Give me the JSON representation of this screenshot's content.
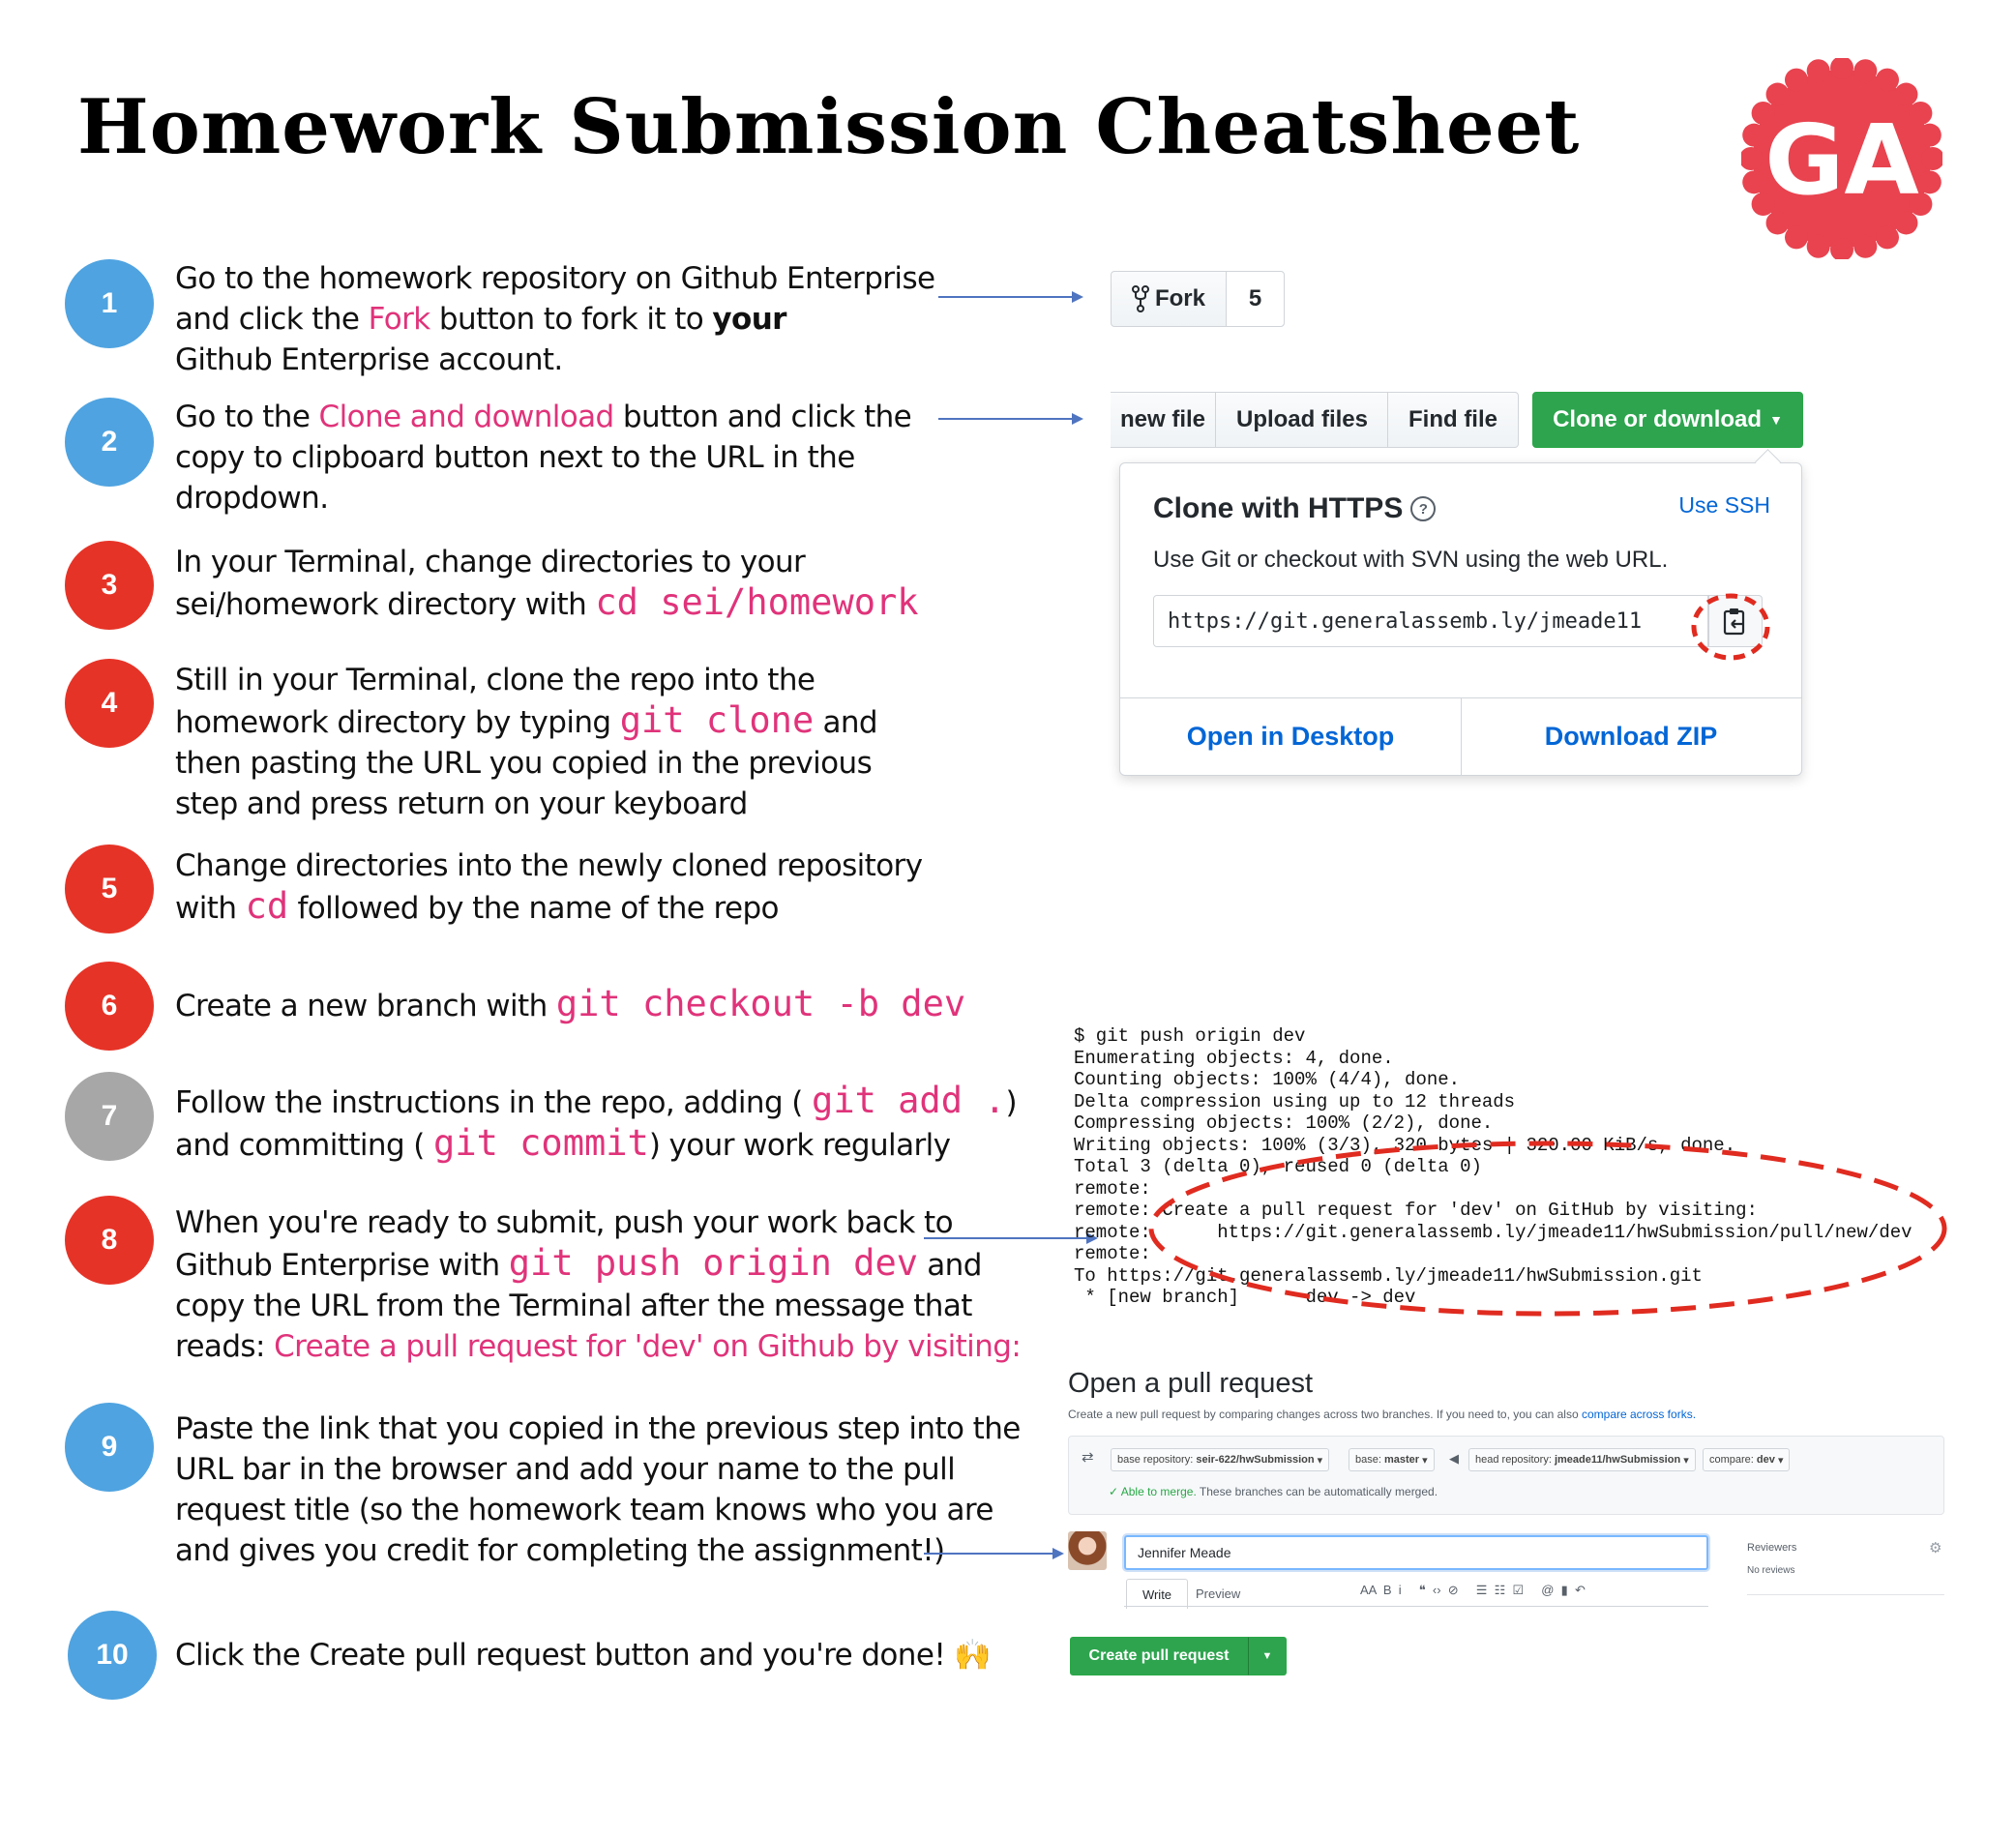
{
  "title": "Homework Submission Cheatsheet",
  "logo": {
    "text": "GA",
    "color": "#e8434f"
  },
  "colors": {
    "pink": "#e0337a",
    "blue": "#4fa3e0",
    "red": "#e63327",
    "gray": "#a7a7a7",
    "green": "#2ea44f"
  },
  "steps": [
    {
      "num": "1",
      "color": "blue"
    },
    {
      "num": "2",
      "color": "blue"
    },
    {
      "num": "3",
      "color": "red"
    },
    {
      "num": "4",
      "color": "red"
    },
    {
      "num": "5",
      "color": "red"
    },
    {
      "num": "6",
      "color": "red"
    },
    {
      "num": "7",
      "color": "gray"
    },
    {
      "num": "8",
      "color": "red"
    },
    {
      "num": "9",
      "color": "blue"
    },
    {
      "num": "10",
      "color": "blue"
    }
  ],
  "text": {
    "s1a": "Go to the homework repository on Github Enterprise",
    "s1b_pre": "and click the ",
    "s1b_hl": "Fork",
    "s1b_mid": " button to fork it to ",
    "s1b_bold": "your",
    "s1c": "Github Enterprise account.",
    "s2a_pre": "Go to the ",
    "s2a_hl": "Clone and download",
    "s2a_post": " button and click the",
    "s2b": "copy to clipboard button next to the URL in the",
    "s2c": "dropdown.",
    "s3a": "In your Terminal, change directories to your",
    "s3b_pre": "sei/homework directory with ",
    "s3b_code": "cd sei/homework",
    "s4a": "Still in your Terminal, clone the repo into the",
    "s4b_pre": "homework directory by typing ",
    "s4b_code": "git clone",
    "s4b_post": "  and",
    "s4c": "then pasting the URL you copied in the previous",
    "s4d": "step and press return on your keyboard",
    "s5a": "Change directories into the newly cloned repository",
    "s5b_pre": "with ",
    "s5b_code": "cd",
    "s5b_post": "  followed by the name of the repo",
    "s6_pre": "Create a new branch with ",
    "s6_code": "git checkout -b dev",
    "s7a_pre": "Follow the instructions in the repo, adding ( ",
    "s7a_code": "git add .",
    "s7a_post": ")",
    "s7b_pre": "and committing ( ",
    "s7b_code": "git commit",
    "s7b_post": ") your work regularly",
    "s8a": "When you're ready to submit, push your work back to",
    "s8b_pre": "Github Enterprise with ",
    "s8b_code": "git push origin dev",
    "s8b_post": "  and",
    "s8c": "copy the URL from the Terminal after the message that",
    "s8d_pre": "reads: ",
    "s8d_hl": "Create a pull request for 'dev' on Github by visiting:",
    "s9a": "Paste the link that you copied in the previous step into the",
    "s9b": "URL bar in the browser and add your name to the pull",
    "s9c": "request title (so the homework team knows who you are",
    "s9d": "and gives you credit for completing the assignment!)",
    "s10": "Click the Create pull request button and you're done! 🙌"
  },
  "fork": {
    "label": "Fork",
    "count": "5"
  },
  "clone": {
    "btn_new_file": "new file",
    "btn_upload": "Upload files",
    "btn_find": "Find file",
    "btn_clone": "Clone or download",
    "heading": "Clone with HTTPS",
    "use_ssh": "Use SSH",
    "desc": "Use Git or checkout with SVN using the web URL.",
    "url": "https://git.generalassemb.ly/jmeade11",
    "open_desktop": "Open in Desktop",
    "download_zip": "Download ZIP"
  },
  "terminal": [
    "$ git push origin dev",
    "Enumerating objects: 4, done.",
    "Counting objects: 100% (4/4), done.",
    "Delta compression using up to 12 threads",
    "Compressing objects: 100% (2/2), done.",
    "Writing objects: 100% (3/3), 320 bytes | 320.00 KiB/s, done.",
    "Total 3 (delta 0), reused 0 (delta 0)",
    "remote:",
    "remote: Create a pull request for 'dev' on GitHub by visiting:",
    "remote:      https://git.generalassemb.ly/jmeade11/hwSubmission/pull/new/dev",
    "remote:",
    "To https://git.generalassemb.ly/jmeade11/hwSubmission.git",
    " * [new branch]      dev -> dev"
  ],
  "pr": {
    "heading": "Open a pull request",
    "desc": "Create a new pull request by comparing changes across two branches. If you need to, you can also",
    "desc_link": "compare across forks.",
    "base_repo_label": "base repository:",
    "base_repo": "seir-622/hwSubmission",
    "base_label": "base:",
    "base": "master",
    "head_repo_label": "head repository:",
    "head_repo": "jmeade11/hwSubmission",
    "compare_label": "compare:",
    "compare": "dev",
    "able": "Able to merge.",
    "able_rest": "These branches can be automatically merged.",
    "title_value": "Jennifer Meade",
    "tab_write": "Write",
    "tab_preview": "Preview",
    "toolbar": "AA  B  i     ❝  ‹›  ⊘     ☰  ☷  ☑     @  ▮  ↶",
    "reviewers": "Reviewers",
    "no_reviews": "No reviews",
    "create_btn": "Create pull request"
  }
}
